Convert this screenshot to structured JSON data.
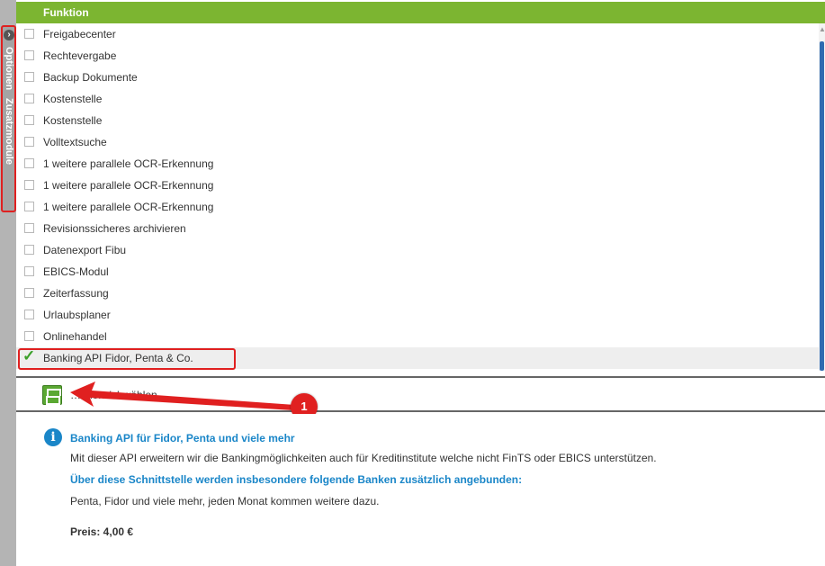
{
  "sidebar": {
    "label_1": "Optionen",
    "label_2": "Zusatzmodule",
    "toggle_glyph": "›"
  },
  "table": {
    "header": "Funktion",
    "rows": [
      {
        "label": "Freigabecenter",
        "checked": false
      },
      {
        "label": "Rechtevergabe",
        "checked": false
      },
      {
        "label": "Backup Dokumente",
        "checked": false
      },
      {
        "label": "Kostenstelle",
        "checked": false
      },
      {
        "label": "Kostenstelle",
        "checked": false
      },
      {
        "label": "Volltextsuche",
        "checked": false
      },
      {
        "label": "1 weitere parallele OCR-Erkennung",
        "checked": false
      },
      {
        "label": "1 weitere parallele OCR-Erkennung",
        "checked": false
      },
      {
        "label": "1 weitere parallele OCR-Erkennung",
        "checked": false
      },
      {
        "label": "Revisionssicheres archivieren",
        "checked": false
      },
      {
        "label": "Datenexport Fibu",
        "checked": false
      },
      {
        "label": "EBICS-Modul",
        "checked": false
      },
      {
        "label": "Zeiterfassung",
        "checked": false
      },
      {
        "label": "Urlaubsplaner",
        "checked": false
      },
      {
        "label": "Onlinehandel",
        "checked": false
      },
      {
        "label": "Banking API Fidor, Penta & Co.",
        "checked": true
      }
    ]
  },
  "save": {
    "label": "…chern/abwählen",
    "icon": "floppy-disk-icon"
  },
  "annotation": {
    "badge": "1"
  },
  "info": {
    "icon": "info-icon",
    "title": "Banking API für Fidor, Penta und viele mehr",
    "description": "Mit dieser API erweitern wir die Bankingmöglichkeiten auch für Kreditinstitute welche nicht FinTS oder EBICS unterstützen.",
    "subtitle": "Über diese Schnittstelle werden insbesondere folgende Banken zusätzlich angebunden:",
    "banks": "Penta, Fidor und viele mehr, jeden Monat kommen weitere dazu.",
    "price": "Preis: 4,00 €"
  },
  "colors": {
    "header_green": "#7cb531",
    "accent_blue": "#1a86c8",
    "annotation_red": "#e02020"
  }
}
